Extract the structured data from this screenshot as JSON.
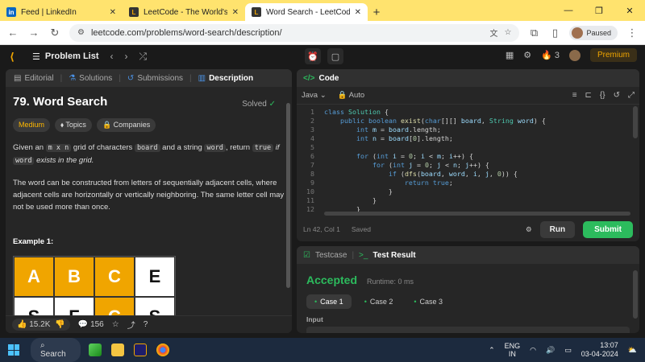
{
  "browser": {
    "tabs": [
      {
        "title": "Feed | LinkedIn",
        "icon": "linkedin-icon",
        "color": "#0a66c2",
        "glyph": "in"
      },
      {
        "title": "LeetCode - The World's Leading",
        "icon": "leetcode-icon",
        "color": "#f0a500",
        "glyph": "L"
      },
      {
        "title": "Word Search - LeetCode",
        "icon": "leetcode-icon",
        "color": "#f0a500",
        "glyph": "L"
      }
    ],
    "new_tab": "+",
    "url": "leetcode.com/problems/word-search/description/",
    "profile_status": "Paused"
  },
  "header": {
    "problem_list": "Problem List",
    "streak": "3",
    "premium": "Premium"
  },
  "left_tabs": [
    {
      "label": "Editorial",
      "icon": "book-icon"
    },
    {
      "label": "Solutions",
      "icon": "flask-icon"
    },
    {
      "label": "Submissions",
      "icon": "history-icon"
    },
    {
      "label": "Description",
      "icon": "document-icon"
    }
  ],
  "problem": {
    "title": "79. Word Search",
    "solved": "Solved",
    "difficulty": "Medium",
    "topics": "Topics",
    "companies": "Companies",
    "desc1_a": "Given an ",
    "desc1_code1": "m x n",
    "desc1_b": " grid of characters ",
    "desc1_code2": "board",
    "desc1_c": " and a string ",
    "desc1_code3": "word",
    "desc1_d": ", return ",
    "desc1_code4": "true",
    "desc1_e": " if ",
    "desc1_code5": "word",
    "desc1_f": " exists in the grid.",
    "desc2": "The word can be constructed from letters of sequentially adjacent cells, where adjacent cells are horizontally or vertically neighboring. The same letter cell may not be used more than once.",
    "example_title": "Example 1:",
    "grid": [
      {
        "ch": "A",
        "hl": true
      },
      {
        "ch": "B",
        "hl": true
      },
      {
        "ch": "C",
        "hl": true
      },
      {
        "ch": "E",
        "hl": false
      },
      {
        "ch": "S",
        "hl": false
      },
      {
        "ch": "F",
        "hl": false
      },
      {
        "ch": "C",
        "hl": true
      },
      {
        "ch": "S",
        "hl": false
      }
    ],
    "likes": "15.2K",
    "comments": "156"
  },
  "editor": {
    "title": "Code",
    "language": "Java",
    "mode": "Auto",
    "status_pos": "Ln 42, Col 1",
    "status_saved": "Saved",
    "run": "Run",
    "submit": "Submit"
  },
  "result": {
    "testcase": "Testcase",
    "test_result": "Test Result",
    "verdict": "Accepted",
    "runtime": "Runtime: 0 ms",
    "cases": [
      "Case 1",
      "Case 2",
      "Case 3"
    ],
    "input_label": "Input"
  },
  "taskbar": {
    "search": "Search",
    "lang_top": "ENG",
    "lang_bot": "IN",
    "time": "13:07",
    "date": "03-04-2024"
  }
}
